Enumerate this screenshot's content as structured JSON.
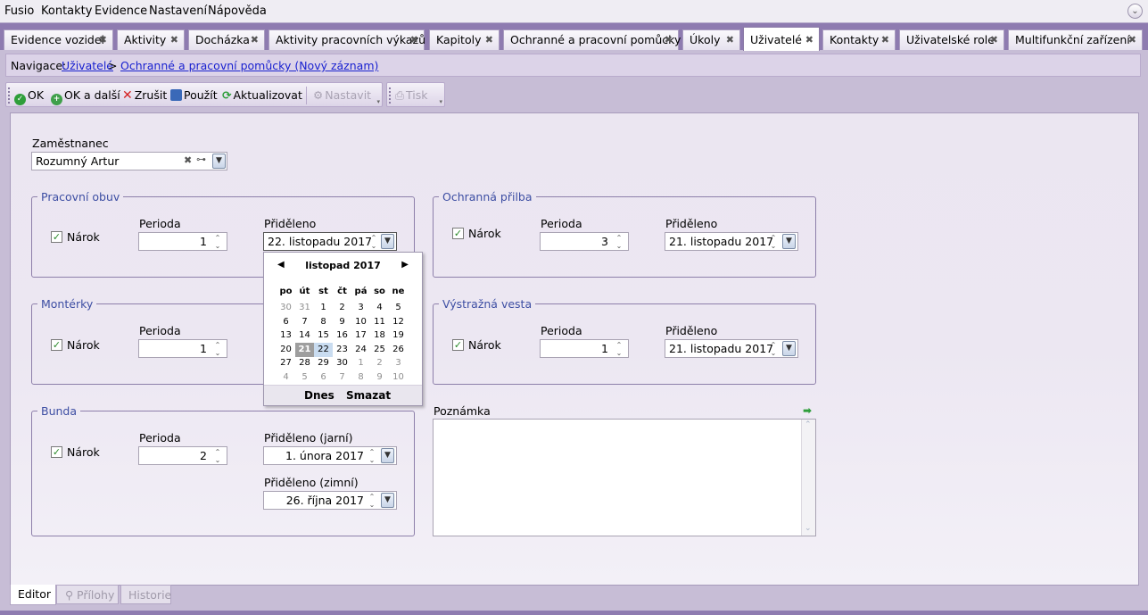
{
  "menu": [
    "Fusio",
    "Kontakty",
    "Evidence",
    "Nastavení",
    "Nápověda"
  ],
  "tabs": [
    {
      "label": "Evidence vozidel"
    },
    {
      "label": "Aktivity"
    },
    {
      "label": "Docházka"
    },
    {
      "label": "Aktivity pracovních výkazů"
    },
    {
      "label": "Kapitoly"
    },
    {
      "label": "Ochranné a pracovní pomůcky"
    },
    {
      "label": "Úkoly"
    },
    {
      "label": "Uživatelé"
    },
    {
      "label": "Kontakty"
    },
    {
      "label": "Uživatelské role"
    },
    {
      "label": "Multifunkční zařízení"
    }
  ],
  "active_tab": "Uživatelé",
  "navigation": {
    "prefix": "Navigace:",
    "link1": "Uživatelé",
    "separator": ">",
    "link2": "Ochranné a pracovní pomůcky (Nový záznam)"
  },
  "toolbar": {
    "ok": "OK",
    "ok_next": "OK a další",
    "cancel": "Zrušit",
    "apply": "Použít",
    "refresh": "Aktualizovat",
    "settings": "Nastavit",
    "print": "Tisk"
  },
  "employee": {
    "label": "Zaměstnanec",
    "value": "Rozumný Artur"
  },
  "groups": {
    "shoes": {
      "title": "Pracovní obuv",
      "claim": "Nárok",
      "period_label": "Perioda",
      "period": "1",
      "assigned_label": "Přiděleno",
      "assigned": "22. listopadu 2017"
    },
    "helmet": {
      "title": "Ochranná přilba",
      "claim": "Nárok",
      "period_label": "Perioda",
      "period": "3",
      "assigned_label": "Přiděleno",
      "assigned": "21. listopadu 2017"
    },
    "overalls": {
      "title": "Montérky",
      "claim": "Nárok",
      "period_label": "Perioda",
      "period": "1"
    },
    "vest": {
      "title": "Výstražná vesta",
      "claim": "Nárok",
      "period_label": "Perioda",
      "period": "1",
      "assigned_label": "Přiděleno",
      "assigned": "21. listopadu 2017"
    },
    "jacket": {
      "title": "Bunda",
      "claim": "Nárok",
      "period_label": "Perioda",
      "period": "2",
      "assigned_spring_label": "Přiděleno (jarní)",
      "assigned_spring": "1. února 2017",
      "assigned_winter_label": "Přiděleno (zimní)",
      "assigned_winter": "26. října 2017"
    }
  },
  "calendar": {
    "month": "listopad 2017",
    "dow": [
      "po",
      "út",
      "st",
      "čt",
      "pá",
      "so",
      "ne"
    ],
    "weeks": [
      [
        "30",
        "31",
        "1",
        "2",
        "3",
        "4",
        "5"
      ],
      [
        "6",
        "7",
        "8",
        "9",
        "10",
        "11",
        "12"
      ],
      [
        "13",
        "14",
        "15",
        "16",
        "17",
        "18",
        "19"
      ],
      [
        "20",
        "21",
        "22",
        "23",
        "24",
        "25",
        "26"
      ],
      [
        "27",
        "28",
        "29",
        "30",
        "1",
        "2",
        "3"
      ],
      [
        "4",
        "5",
        "6",
        "7",
        "8",
        "9",
        "10"
      ]
    ],
    "today": "21",
    "selected": "22",
    "today_button": "Dnes",
    "clear_button": "Smazat"
  },
  "note": {
    "label": "Poznámka",
    "value": ""
  },
  "bottom_tabs": [
    "Editor",
    "Přílohy",
    "Historie"
  ]
}
